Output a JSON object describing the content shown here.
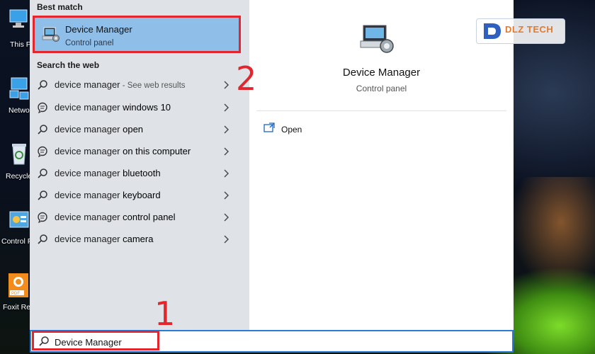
{
  "desktop": {
    "icons": [
      {
        "label": "This P",
        "name": "this-pc-icon"
      },
      {
        "label": "Netwo",
        "name": "network-icon"
      },
      {
        "label": "Recycle",
        "name": "recycle-bin-icon"
      },
      {
        "label": "Control P",
        "name": "control-panel-icon"
      },
      {
        "label": "Foxit Re",
        "name": "foxit-reader-icon"
      }
    ]
  },
  "start": {
    "best_match_heading": "Best match",
    "best_match": {
      "title": "Device Manager",
      "subtitle": "Control panel",
      "icon": "device-manager-icon"
    },
    "web_heading": "Search the web",
    "web_results": [
      {
        "prefix": "device manager",
        "suffix": " - See web results",
        "bold": "",
        "icon": "search-icon"
      },
      {
        "prefix": "device manager",
        "suffix": "",
        "bold": " windows 10",
        "icon": "web-bubble-icon"
      },
      {
        "prefix": "device manager",
        "suffix": "",
        "bold": " open",
        "icon": "search-icon"
      },
      {
        "prefix": "device manager",
        "suffix": "",
        "bold": " on this computer",
        "icon": "web-bubble-icon"
      },
      {
        "prefix": "device manager",
        "suffix": "",
        "bold": " bluetooth",
        "icon": "search-icon"
      },
      {
        "prefix": "device manager",
        "suffix": "",
        "bold": " keyboard",
        "icon": "search-icon"
      },
      {
        "prefix": "device manager",
        "suffix": "",
        "bold": " control panel",
        "icon": "web-bubble-icon"
      },
      {
        "prefix": "device manager",
        "suffix": "",
        "bold": " camera",
        "icon": "search-icon"
      }
    ]
  },
  "detail": {
    "title": "Device Manager",
    "subtitle": "Control panel",
    "actions": [
      {
        "label": "Open",
        "icon": "open-window-icon"
      }
    ]
  },
  "annotations": {
    "marker_1": "1",
    "marker_2": "2"
  },
  "watermark": {
    "text": "DLZ TECH"
  },
  "search": {
    "value": "Device Manager"
  },
  "colors": {
    "highlight_red": "#e3262d",
    "selection_blue": "#8fbfe8",
    "accent_blue": "#2b7ad6"
  }
}
